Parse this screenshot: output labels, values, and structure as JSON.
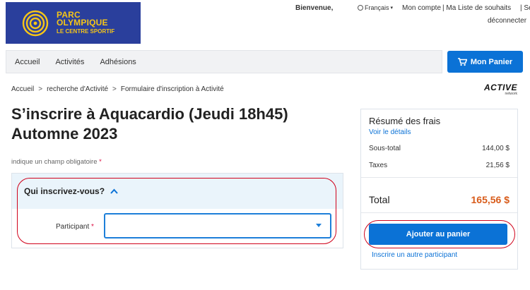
{
  "brand": {
    "line1": "PARC",
    "line2": "OLYMPIQUE",
    "line3": "LE CENTRE SPORTIF"
  },
  "toplinks": {
    "welcome": "Bienvenue,",
    "language": "Français",
    "account": "Mon compte",
    "wishlist": "| Ma Liste de souhaits",
    "logout_a": "| Se",
    "logout_b": "déconnecter"
  },
  "nav": {
    "items": [
      "Accueil",
      "Activités",
      "Adhésions"
    ],
    "cart": "Mon Panier"
  },
  "breadcrumb": [
    "Accueil",
    "recherche d'Activité",
    "Formulaire d'inscription à Activité"
  ],
  "partner_logo": "ACTIVE",
  "partner_sub": "network",
  "title": "S’inscrire à Aquacardio (Jeudi 18h45) Automne 2023",
  "required_note": "indique un champ obligatoire",
  "required_star": "*",
  "form": {
    "section_title": "Qui inscrivez-vous?",
    "participant_label": "Participant",
    "participant_value": ""
  },
  "summary": {
    "title": "Résumé des frais",
    "details_link": "Voir le détails",
    "rows": [
      {
        "label": "Sous-total",
        "value": "144,00 $"
      },
      {
        "label": "Taxes",
        "value": "21,56 $"
      }
    ],
    "total_label": "Total",
    "total_value": "165,56 $",
    "add_button": "Ajouter au panier",
    "other_participant": "Inscrire un autre participant"
  },
  "colors": {
    "brand_blue": "#2a3f9c",
    "brand_yellow": "#f5c518",
    "accent": "#0b72d6",
    "total": "#d85b1a",
    "annotation": "#d0021b"
  }
}
